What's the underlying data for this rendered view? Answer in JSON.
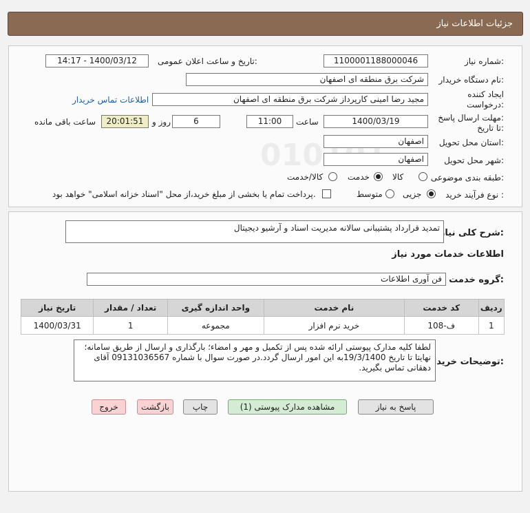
{
  "title": "جزئیات اطلاعات نیاز",
  "watermark": {
    "line1": "ParsNamadData",
    "line2": "مرکز فرآوری اطلاعات پارس نماد داده",
    "number": "021-88349670"
  },
  "fields": {
    "need_number_label": "شماره نیاز:",
    "need_number": "1100001188000046",
    "announce_label": "تاریخ و ساعت اعلان عمومی:",
    "announce_value": "1400/03/12 - 14:17",
    "buyer_org_label": "نام دستگاه خریدار:",
    "buyer_org": "شرکت برق منطقه ای اصفهان",
    "creator_label": "ایجاد کننده",
    "creator_label2": "درخواست:",
    "creator": "مجید رضا امینی کارپرداز شرکت برق منطقه ای اصفهان",
    "contact_link": "اطلاعات تماس خریدار",
    "deadline_label": "مهلت ارسال پاسخ:",
    "deadline_label2": "تا تاریخ:",
    "deadline_date": "1400/03/19",
    "time_label": "ساعت",
    "deadline_time": "11:00",
    "days": "6",
    "days_label": "روز و",
    "remaining": "20:01:51",
    "remaining_label": "ساعت باقی مانده",
    "province_label": "استان محل تحویل:",
    "province": "اصفهان",
    "city_label": "شهر محل تحویل:",
    "city": "اصفهان",
    "category_label": "طبقه بندی موضوعی:",
    "category_options": [
      "کالا",
      "خدمت",
      "کالا/خدمت"
    ],
    "category_selected": "خدمت",
    "process_label": "نوع فرآیند خرید :",
    "process_options": [
      "جزیی",
      "متوسط"
    ],
    "process_selected": "جزیی",
    "payment_note": "پرداخت تمام یا بخشی از مبلغ خرید،از محل \"اسناد خزانه اسلامی\" خواهد بود."
  },
  "description": {
    "label": "شرح کلی نیاز:",
    "text": "تمدید قرارداد پشتیبانی سالانه مدیریت اسناد و آرشیو دیجیتال"
  },
  "services": {
    "section_title": "اطلاعات خدمات مورد نیاز",
    "group_label": "گروه خدمت:",
    "group_value": "فن آوری اطلاعات",
    "columns": [
      "ردیف",
      "کد خدمت",
      "نام خدمت",
      "واحد اندازه گیری",
      "تعداد / مقدار",
      "تاریخ نیاز"
    ],
    "rows": [
      [
        "1",
        "ف-108",
        "خرید نرم افزار",
        "مجموعه",
        "1",
        "1400/03/31"
      ]
    ]
  },
  "buyer_notes": {
    "label": "توضیحات خریدار:",
    "text": "لطفا کلیه مدارک پیوستی ارائه شده  پس از تکمیل و مهر و امضاء؛ بارگذاری و ارسال از طریق سامانه؛ نهایتا تا تاریخ 19/3/1400به این امور ارسال گردد.در صورت سوال با شماره 09131036567 آقای دهقانی تماس بگیرید."
  },
  "buttons": {
    "reply": "پاسخ به نیاز",
    "attachments": "مشاهده مدارک پیوستی (1)",
    "print": "چاپ",
    "back": "بازگشت",
    "exit": "خروج"
  }
}
